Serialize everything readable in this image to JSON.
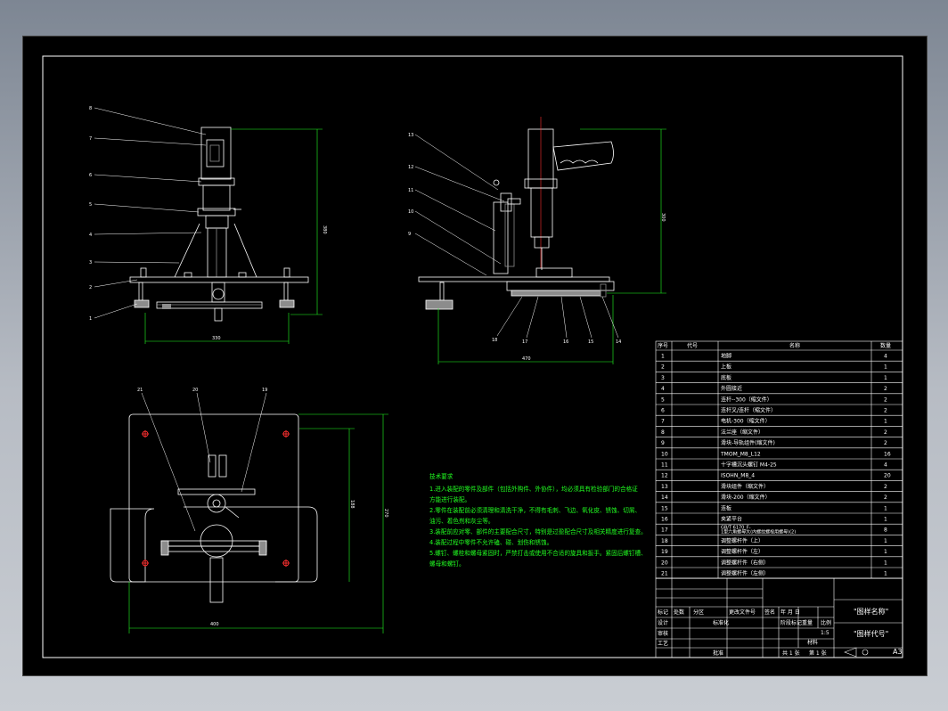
{
  "notes": {
    "title": "技术要求",
    "lines": [
      "1.进入装配的零件及部件（包括外购件、外协件），均必须具有检验部门的合格证",
      "方能进行装配。",
      "2.零件在装配前必须清理和清洗干净，不得有毛刺、飞边、氧化皮、锈蚀、切屑、",
      "油污、着色剂和灰尘等。",
      "3.装配前应对零、部件的主要配合尺寸，特别是过盈配合尺寸及相关精度进行复查。",
      "4.装配过程中零件不允许磕、碰、划伤和锈蚀。",
      "5.螺钉、螺栓和螺母紧固时，严禁打击或使用不合适的旋具和扳手。紧固后螺钉槽、",
      "螺母和螺钉。"
    ]
  },
  "bom": {
    "headers": [
      "序号",
      "代号",
      "名称",
      "数量"
    ],
    "rows": [
      {
        "no": "1",
        "name": "地脚",
        "qty": "4"
      },
      {
        "no": "2",
        "name": "上板",
        "qty": "1"
      },
      {
        "no": "3",
        "name": "底板",
        "qty": "1"
      },
      {
        "no": "4",
        "name": "外圆接近",
        "qty": "2"
      },
      {
        "no": "5",
        "name": "连杆--300（缩文件）",
        "qty": "2"
      },
      {
        "no": "6",
        "name": "连杆叉/连杆（缩文件）",
        "qty": "2"
      },
      {
        "no": "7",
        "name": "电机-300（缩文件）",
        "qty": "1"
      },
      {
        "no": "8",
        "name": "法兰座（缩文件）",
        "qty": "2"
      },
      {
        "no": "9",
        "name": "滑块-导轨组件(缩文件)",
        "qty": "2"
      },
      {
        "no": "10",
        "name": "TMOM_M8_L12",
        "qty": "16"
      },
      {
        "no": "11",
        "name": "十字槽沉头螺钉 M4-25",
        "qty": "4"
      },
      {
        "no": "12",
        "name": "ISOHN_M8_4",
        "qty": "20"
      },
      {
        "no": "13",
        "name": "滑块组件（缩文件）",
        "qty": "2"
      },
      {
        "no": "14",
        "name": "滑块-200（缩文件）",
        "qty": "2"
      },
      {
        "no": "15",
        "name": "连板",
        "qty": "1"
      },
      {
        "no": "16",
        "name": "夹紧平台",
        "qty": "1"
      },
      {
        "no": "17",
        "name": "GB/T 6170_F-\n1型六角螺母大(内螺纹螺栓用螺母)(2)",
        "qty": "8"
      },
      {
        "no": "18",
        "name": "调整螺杆件（上）",
        "qty": "1"
      },
      {
        "no": "19",
        "name": "调整螺杆件（左）",
        "qty": "1"
      },
      {
        "no": "20",
        "name": "调整螺杆件（右侧）",
        "qty": "1"
      },
      {
        "no": "21",
        "name": "调整螺杆件（左侧）",
        "qty": "1"
      }
    ]
  },
  "title_block": {
    "drawing_name": "\"图样名称\"",
    "drawing_code": "\"图样代号\"",
    "row_labels": [
      "标记",
      "处数",
      "分区",
      "更改文件号",
      "签名",
      "年 月 日"
    ],
    "design": "设计",
    "standard": "标准化",
    "stage_mark": "阶段标记",
    "weight": "重量",
    "scale": "比例",
    "scale_value": "1:5",
    "check": "审核",
    "process": "工艺",
    "approve": "批准",
    "total_sheets": "共 1 张",
    "sheet": "第 1 张",
    "paper": "A3",
    "material": "材料"
  },
  "front_view": {
    "callouts": [
      "8",
      "7",
      "6",
      "5",
      "4",
      "3",
      "2",
      "1"
    ],
    "dim_height": "380",
    "dim_width": "330"
  },
  "side_view": {
    "callouts_left": [
      "13",
      "12",
      "11",
      "10",
      "9"
    ],
    "callouts_bottom": [
      "18",
      "17",
      "16",
      "15",
      "14"
    ],
    "dim_height": "300",
    "dim_width": "470"
  },
  "top_view": {
    "callouts": [
      "21",
      "20",
      "19"
    ],
    "dim_height_inner": "188",
    "dim_height_outer": "270",
    "dim_width": "400"
  },
  "colors": {
    "background": "#000000",
    "frame": "#ffffff",
    "part": "#ffffff",
    "dimension": "#21ff21",
    "notes": "#21ff21",
    "gray": "#8c8c8c"
  }
}
